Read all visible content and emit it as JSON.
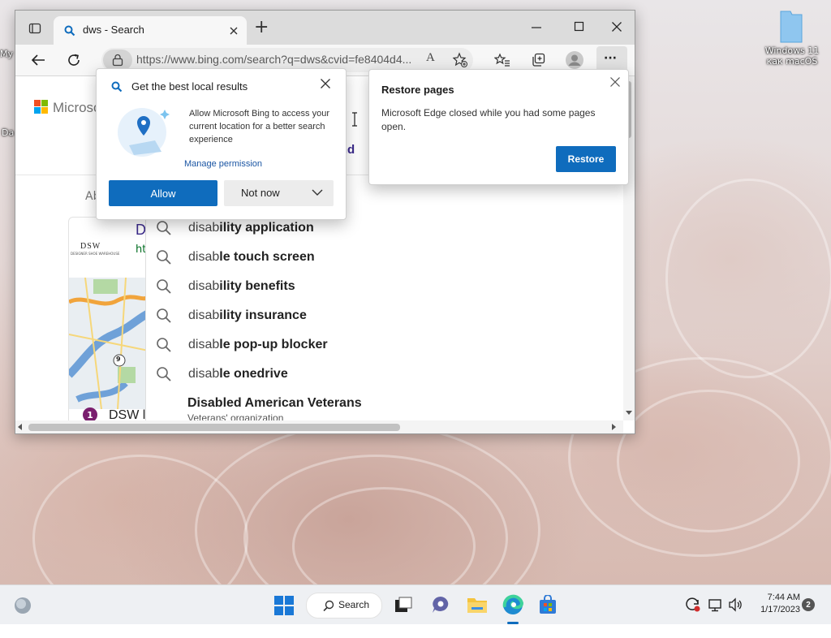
{
  "desktop": {
    "icons": [
      {
        "label_line1": "Windows 11",
        "label_line2": "как macOS"
      }
    ],
    "left_clip": {
      "text1": "My",
      "text2": "Da"
    }
  },
  "browser": {
    "tab_title": "dws - Search",
    "new_tab_symbol": "+",
    "url": "https://www.bing.com/search?q=dws&cvid=fe8404d4...",
    "read_aloud_symbol": "A",
    "more_symbol": "···"
  },
  "page": {
    "brand": "Microsoft",
    "about_clip": "Ab",
    "result_initial": "D",
    "result_url_clip": "ht",
    "result_badge_num": "1",
    "result_title_clip": "DSW l",
    "logo_text": "DSW",
    "logo_subtext": "DESIGNER SHOE WAREHOUSE",
    "side_text_clip": "wind",
    "map_route_label": "9"
  },
  "suggestions": [
    {
      "plain": "disab",
      "bold": "ility application"
    },
    {
      "plain": "disab",
      "bold": "le touch screen"
    },
    {
      "plain": "disab",
      "bold": "ility benefits"
    },
    {
      "plain": "disab",
      "bold": "ility insurance"
    },
    {
      "plain": "disab",
      "bold": "le pop-up blocker"
    },
    {
      "plain": "disab",
      "bold": "le onedrive"
    }
  ],
  "entity_suggestion": {
    "title": "Disabled American Veterans",
    "subtitle": "Veterans' organization"
  },
  "location_popup": {
    "title": "Get the best local results",
    "body": "Allow Microsoft Bing to access your current location for a better search experience",
    "manage": "Manage permission",
    "allow": "Allow",
    "not_now": "Not now"
  },
  "restore_popup": {
    "title": "Restore pages",
    "body": "Microsoft Edge closed while you had some pages open.",
    "button": "Restore"
  },
  "taskbar": {
    "search_label": "Search",
    "time": "7:44 AM",
    "date": "1/17/2023",
    "notification_count": "2"
  },
  "colors": {
    "accent": "#0f6cbd",
    "link": "#1a55a3",
    "result_purple": "#3b2a8c"
  }
}
